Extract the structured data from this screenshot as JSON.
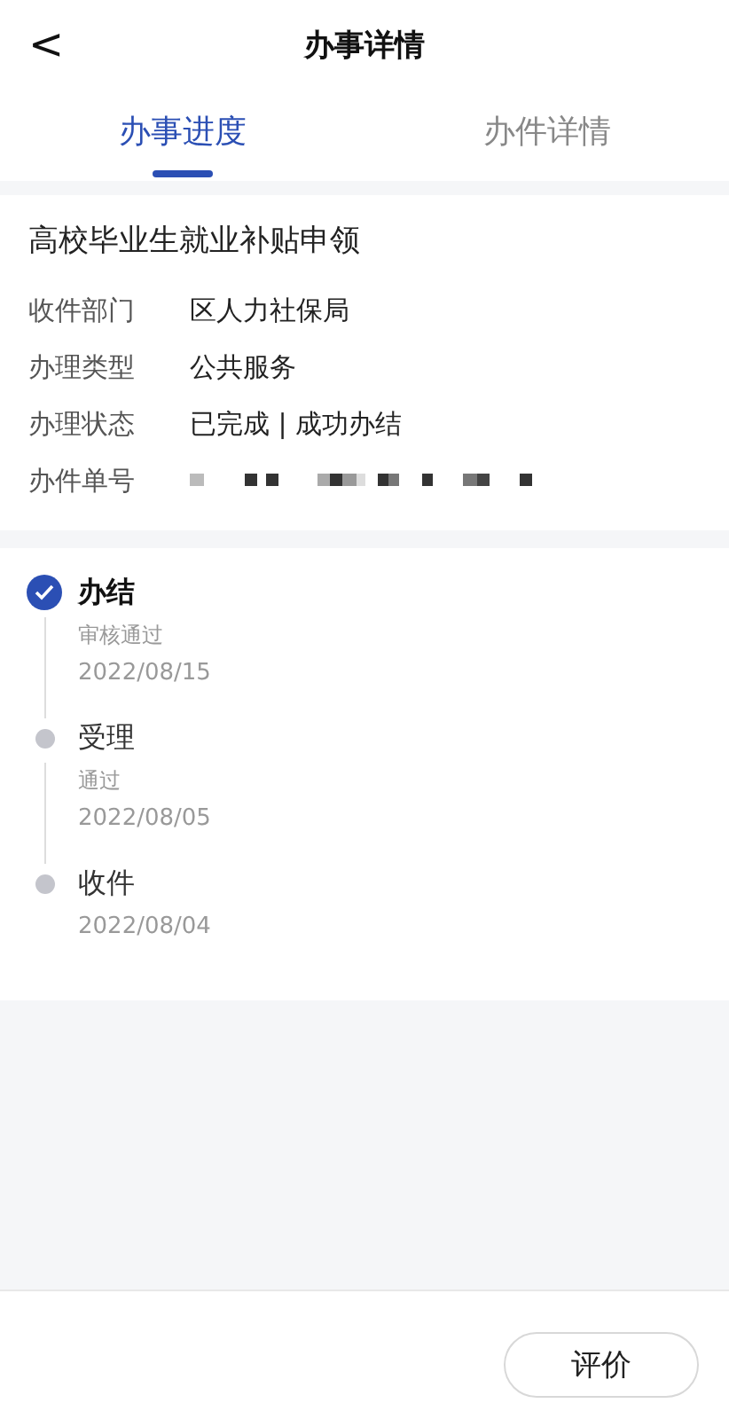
{
  "header": {
    "back_icon": "<",
    "title": "办事详情"
  },
  "tabs": [
    {
      "label": "办事进度",
      "selected": true
    },
    {
      "label": "办件详情",
      "selected": false
    }
  ],
  "item": {
    "title": "高校毕业生就业补贴申领",
    "fields": [
      {
        "label": "收件部门",
        "value": "区人力社保局"
      },
      {
        "label": "办理类型",
        "value": "公共服务"
      },
      {
        "label": "办理状态",
        "value": "已完成 | 成功办结"
      },
      {
        "label": "办件单号",
        "kind": "redacted"
      }
    ]
  },
  "progress": [
    {
      "title": "办结",
      "note": "审核通过",
      "date": "2022/08/15",
      "done": true
    },
    {
      "title": "受理",
      "note": "通过",
      "date": "2022/08/05",
      "done": false
    },
    {
      "title": "收件",
      "date": "2022/08/04",
      "done": false
    }
  ],
  "buttons": [
    "评价"
  ]
}
